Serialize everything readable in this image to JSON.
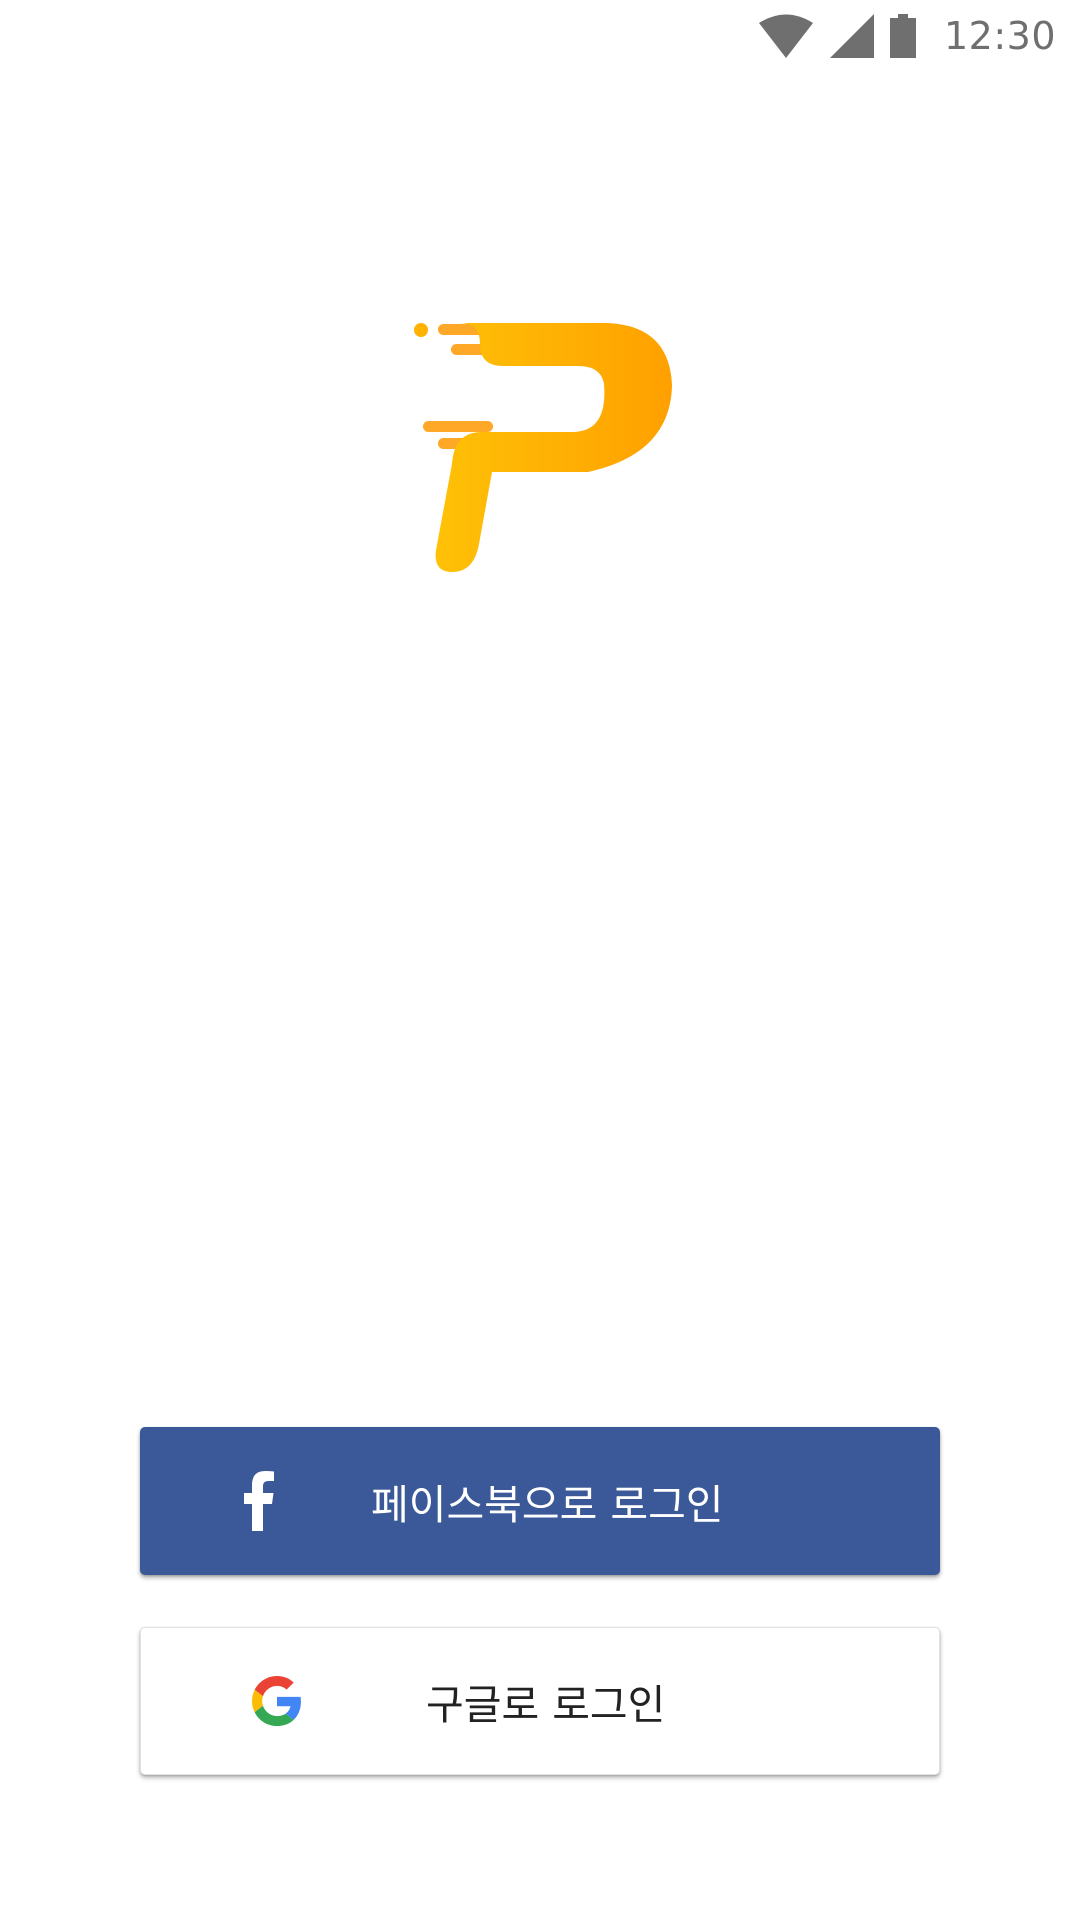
{
  "status_bar": {
    "time": "12:30",
    "icons": [
      "wifi-icon",
      "cell-signal-icon",
      "battery-icon"
    ],
    "icon_color": "#6f6f6f"
  },
  "app": {
    "logo_icon": "p-logo-icon",
    "logo_colors": [
      "#ffc107",
      "#ffa000"
    ]
  },
  "login": {
    "facebook": {
      "label": "페이스북으로 로그인",
      "icon": "facebook-icon",
      "background": "#3b5998",
      "text_color": "#ffffff"
    },
    "google": {
      "label": "구글로 로그인",
      "icon": "google-icon",
      "background": "#ffffff",
      "text_color": "#222222"
    }
  }
}
